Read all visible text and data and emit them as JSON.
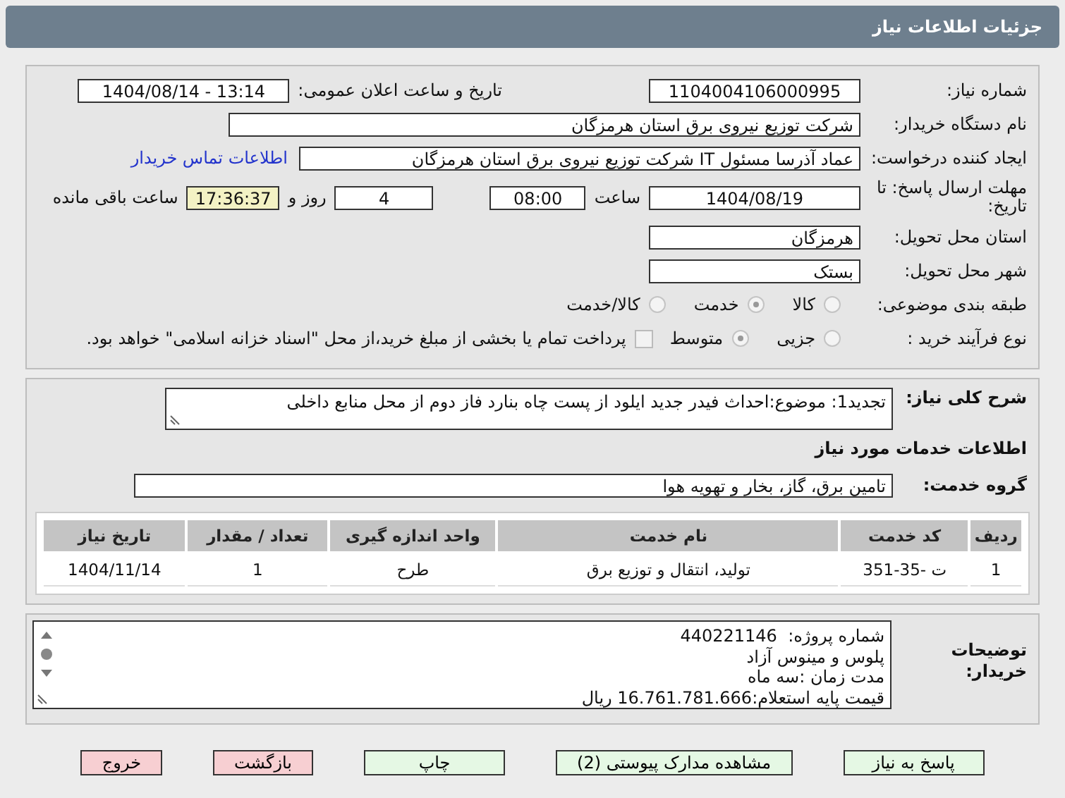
{
  "title": "جزئیات اطلاعات نیاز",
  "need_number": {
    "label": "شماره نیاز:",
    "value": "1104004106000995"
  },
  "announce": {
    "label": "تاریخ و ساعت اعلان عمومی:",
    "value": "1404/08/14 - 13:14"
  },
  "buyer": {
    "label": "نام دستگاه خریدار:",
    "value": "شرکت توزیع نیروی برق استان هرمزگان"
  },
  "creator": {
    "label": "ایجاد کننده درخواست:",
    "value": "عماد آذرسا مسئول IT شرکت توزیع نیروی برق استان هرمزگان",
    "link": "اطلاعات تماس خریدار"
  },
  "deadline": {
    "label": "مهلت ارسال پاسخ: تا تاریخ:",
    "date": "1404/08/19",
    "time_label": "ساعت",
    "time": "08:00",
    "days": "4",
    "days_label": "روز و",
    "remaining": "17:36:37",
    "remaining_label": "ساعت باقی مانده"
  },
  "province": {
    "label": "استان محل تحویل:",
    "value": "هرمزگان"
  },
  "city": {
    "label": "شهر محل تحویل:",
    "value": "بستک"
  },
  "category": {
    "label": "طبقه بندی موضوعی:",
    "options": [
      {
        "label": "کالا",
        "selected": false
      },
      {
        "label": "خدمت",
        "selected": true
      },
      {
        "label": "کالا/خدمت",
        "selected": false
      }
    ]
  },
  "process": {
    "label": "نوع فرآیند خرید :",
    "options": [
      {
        "label": "جزیی",
        "selected": false
      },
      {
        "label": "متوسط",
        "selected": true
      }
    ],
    "payment": {
      "checked": false,
      "text": "پرداخت تمام یا بخشی از مبلغ خرید،از محل \"اسناد خزانه اسلامی\" خواهد بود."
    }
  },
  "description": {
    "label": "شرح کلی نیاز:",
    "value": "تجدید1: موضوع:احداث فیدر جدید ایلود از پست چاه بنارد فاز دوم از محل منابع داخلی"
  },
  "services_heading": "اطلاعات خدمات مورد نیاز",
  "service_group": {
    "label": "گروه خدمت:",
    "value": "تامین برق، گاز، بخار و تهویه هوا"
  },
  "table": {
    "columns": [
      "ردیف",
      "کد خدمت",
      "نام خدمت",
      "واحد اندازه گیری",
      "تعداد / مقدار",
      "تاریخ نیاز"
    ],
    "rows": [
      [
        "1",
        "ت -35-351",
        "تولید، انتقال و توزیع برق",
        "طرح",
        "1",
        "1404/11/14"
      ]
    ]
  },
  "notes": {
    "label": "توضیحات خریدار:",
    "lines": [
      "شماره پروژه:  440221146",
      "پلوس و مینوس آزاد",
      "مدت زمان :سه ماه",
      "قیمت پایه استعلام:16.761.781.666 ریال"
    ]
  },
  "buttons": [
    {
      "label": "پاسخ به نیاز",
      "kind": "action"
    },
    {
      "label": "مشاهده مدارک پیوستی (2)",
      "kind": "action"
    },
    {
      "label": "چاپ",
      "kind": "action"
    },
    {
      "label": "بازگشت",
      "kind": "exit"
    },
    {
      "label": "خروج",
      "kind": "exit"
    }
  ]
}
